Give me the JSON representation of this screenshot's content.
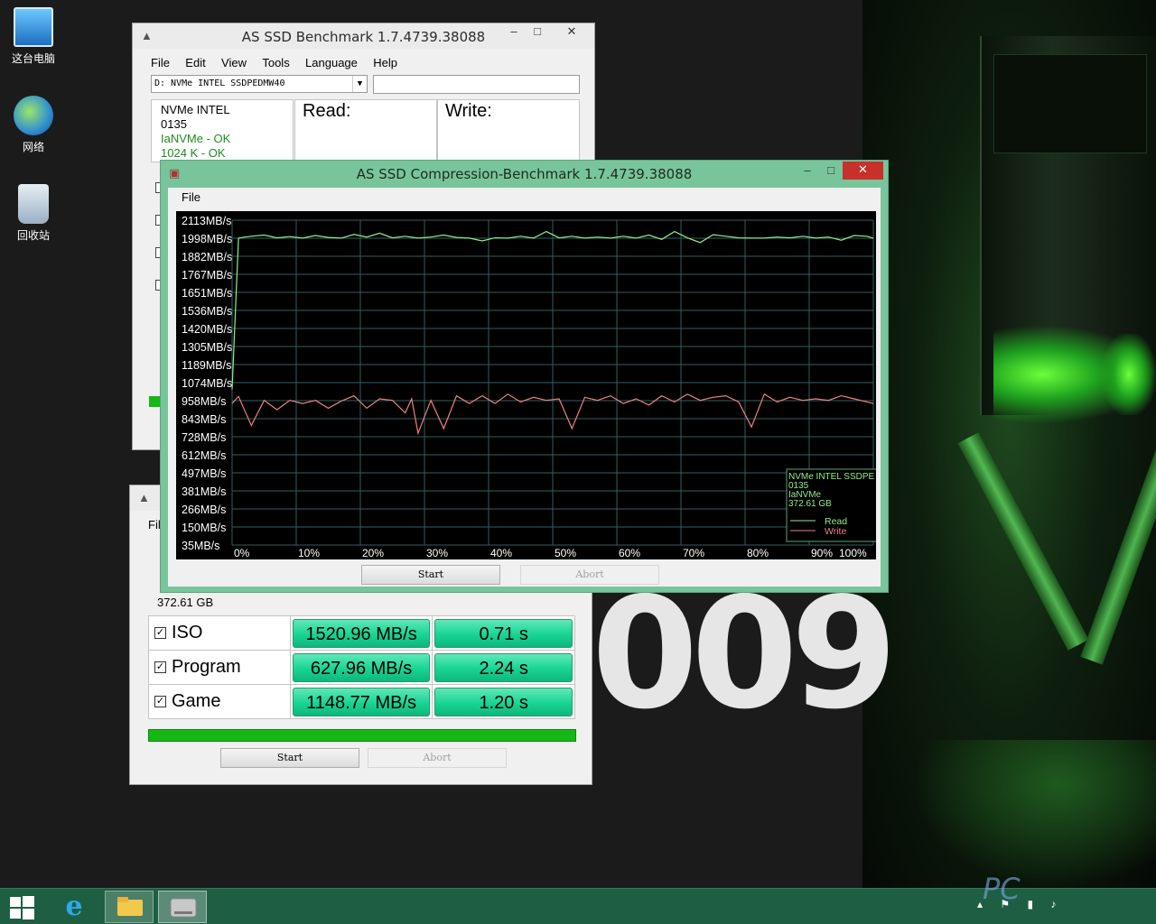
{
  "desktop": {
    "icons": [
      {
        "label": "这台电脑"
      },
      {
        "label": "网络"
      },
      {
        "label": "回收站"
      }
    ],
    "wallpaper_text": "009"
  },
  "main_window": {
    "title": "AS SSD Benchmark 1.7.4739.38088",
    "menu": [
      "File",
      "Edit",
      "View",
      "Tools",
      "Language",
      "Help"
    ],
    "drive_selected": "D: NVMe INTEL SSDPEDMW40",
    "info": {
      "model": "NVMe INTEL",
      "firmware": "0135",
      "driver": "IaNVMe - OK",
      "alignment": "1024 K - OK"
    },
    "read_header": "Read:",
    "write_header": "Write:"
  },
  "copy_window": {
    "menu_partial": "Fil",
    "capacity": "372.61 GB",
    "rows": [
      {
        "label": "ISO",
        "speed": "1520.96 MB/s",
        "time": "0.71 s",
        "checked": true
      },
      {
        "label": "Program",
        "speed": "627.96 MB/s",
        "time": "2.24 s",
        "checked": true
      },
      {
        "label": "Game",
        "speed": "1148.77 MB/s",
        "time": "1.20 s",
        "checked": true
      }
    ],
    "progress": 1.0,
    "start_label": "Start",
    "abort_label": "Abort"
  },
  "compression_window": {
    "title": "AS SSD Compression-Benchmark 1.7.4739.38088",
    "menu": [
      "File"
    ],
    "start_label": "Start",
    "abort_label": "Abort",
    "legend": {
      "lines": [
        "NVMe INTEL SSDPE",
        "0135",
        "IaNVMe",
        "372.61 GB"
      ],
      "read": "Read",
      "write": "Write"
    },
    "colors": {
      "read": "#90ee90",
      "write": "#f08080",
      "grid": "#2f5f5f",
      "text": "#ffffff",
      "legend_border": "#5aa57d"
    }
  },
  "chart_data": {
    "type": "line",
    "title": "",
    "xlabel": "",
    "ylabel": "",
    "x_ticks": [
      "0%",
      "10%",
      "20%",
      "30%",
      "40%",
      "50%",
      "60%",
      "70%",
      "80%",
      "90%",
      "100%"
    ],
    "y_ticks": [
      "2113MB/s",
      "1998MB/s",
      "1882MB/s",
      "1767MB/s",
      "1651MB/s",
      "1536MB/s",
      "1420MB/s",
      "1305MB/s",
      "1189MB/s",
      "1074MB/s",
      "958MB/s",
      "843MB/s",
      "728MB/s",
      "612MB/s",
      "497MB/s",
      "381MB/s",
      "266MB/s",
      "150MB/s",
      "35MB/s"
    ],
    "ylim": [
      35,
      2113
    ],
    "xlim": [
      0,
      100
    ],
    "grid": true,
    "legend_position": "bottom-right",
    "series": [
      {
        "name": "Read",
        "x": [
          0,
          1,
          2,
          3,
          5,
          7,
          9,
          11,
          13,
          15,
          17,
          19,
          21,
          23,
          25,
          27,
          29,
          31,
          33,
          35,
          37,
          39,
          41,
          43,
          45,
          47,
          49,
          51,
          53,
          55,
          57,
          59,
          61,
          63,
          65,
          67,
          69,
          71,
          73,
          75,
          77,
          79,
          81,
          83,
          85,
          87,
          89,
          91,
          93,
          95,
          97,
          99,
          100
        ],
        "y": [
          1030,
          1998,
          2005,
          2010,
          2018,
          2000,
          2008,
          1998,
          2015,
          2003,
          1998,
          2022,
          2005,
          2030,
          2000,
          2010,
          1998,
          2005,
          2018,
          2003,
          1998,
          1980,
          2000,
          1998,
          2010,
          1998,
          2040,
          2000,
          2010,
          1998,
          2005,
          1998,
          2010,
          1998,
          2018,
          1990,
          2040,
          2000,
          1970,
          2020,
          2010,
          2000,
          1998,
          1998,
          2005,
          2000,
          2010,
          1998,
          2005,
          1985,
          2015,
          2010,
          1998
        ]
      },
      {
        "name": "Write",
        "x": [
          0,
          1,
          3,
          5,
          7,
          9,
          11,
          13,
          15,
          17,
          19,
          21,
          23,
          25,
          27,
          28,
          29,
          31,
          33,
          35,
          37,
          39,
          41,
          43,
          45,
          47,
          49,
          51,
          53,
          55,
          57,
          59,
          61,
          63,
          65,
          67,
          69,
          71,
          73,
          75,
          77,
          79,
          81,
          83,
          85,
          87,
          89,
          91,
          93,
          95,
          97,
          100
        ],
        "y": [
          940,
          985,
          800,
          960,
          900,
          960,
          940,
          960,
          910,
          955,
          990,
          910,
          970,
          960,
          880,
          970,
          750,
          960,
          780,
          990,
          940,
          990,
          940,
          1000,
          950,
          980,
          960,
          970,
          780,
          980,
          960,
          990,
          940,
          970,
          930,
          990,
          950,
          1000,
          960,
          980,
          990,
          950,
          790,
          1000,
          950,
          980,
          960,
          970,
          960,
          990,
          970,
          940
        ]
      }
    ]
  }
}
